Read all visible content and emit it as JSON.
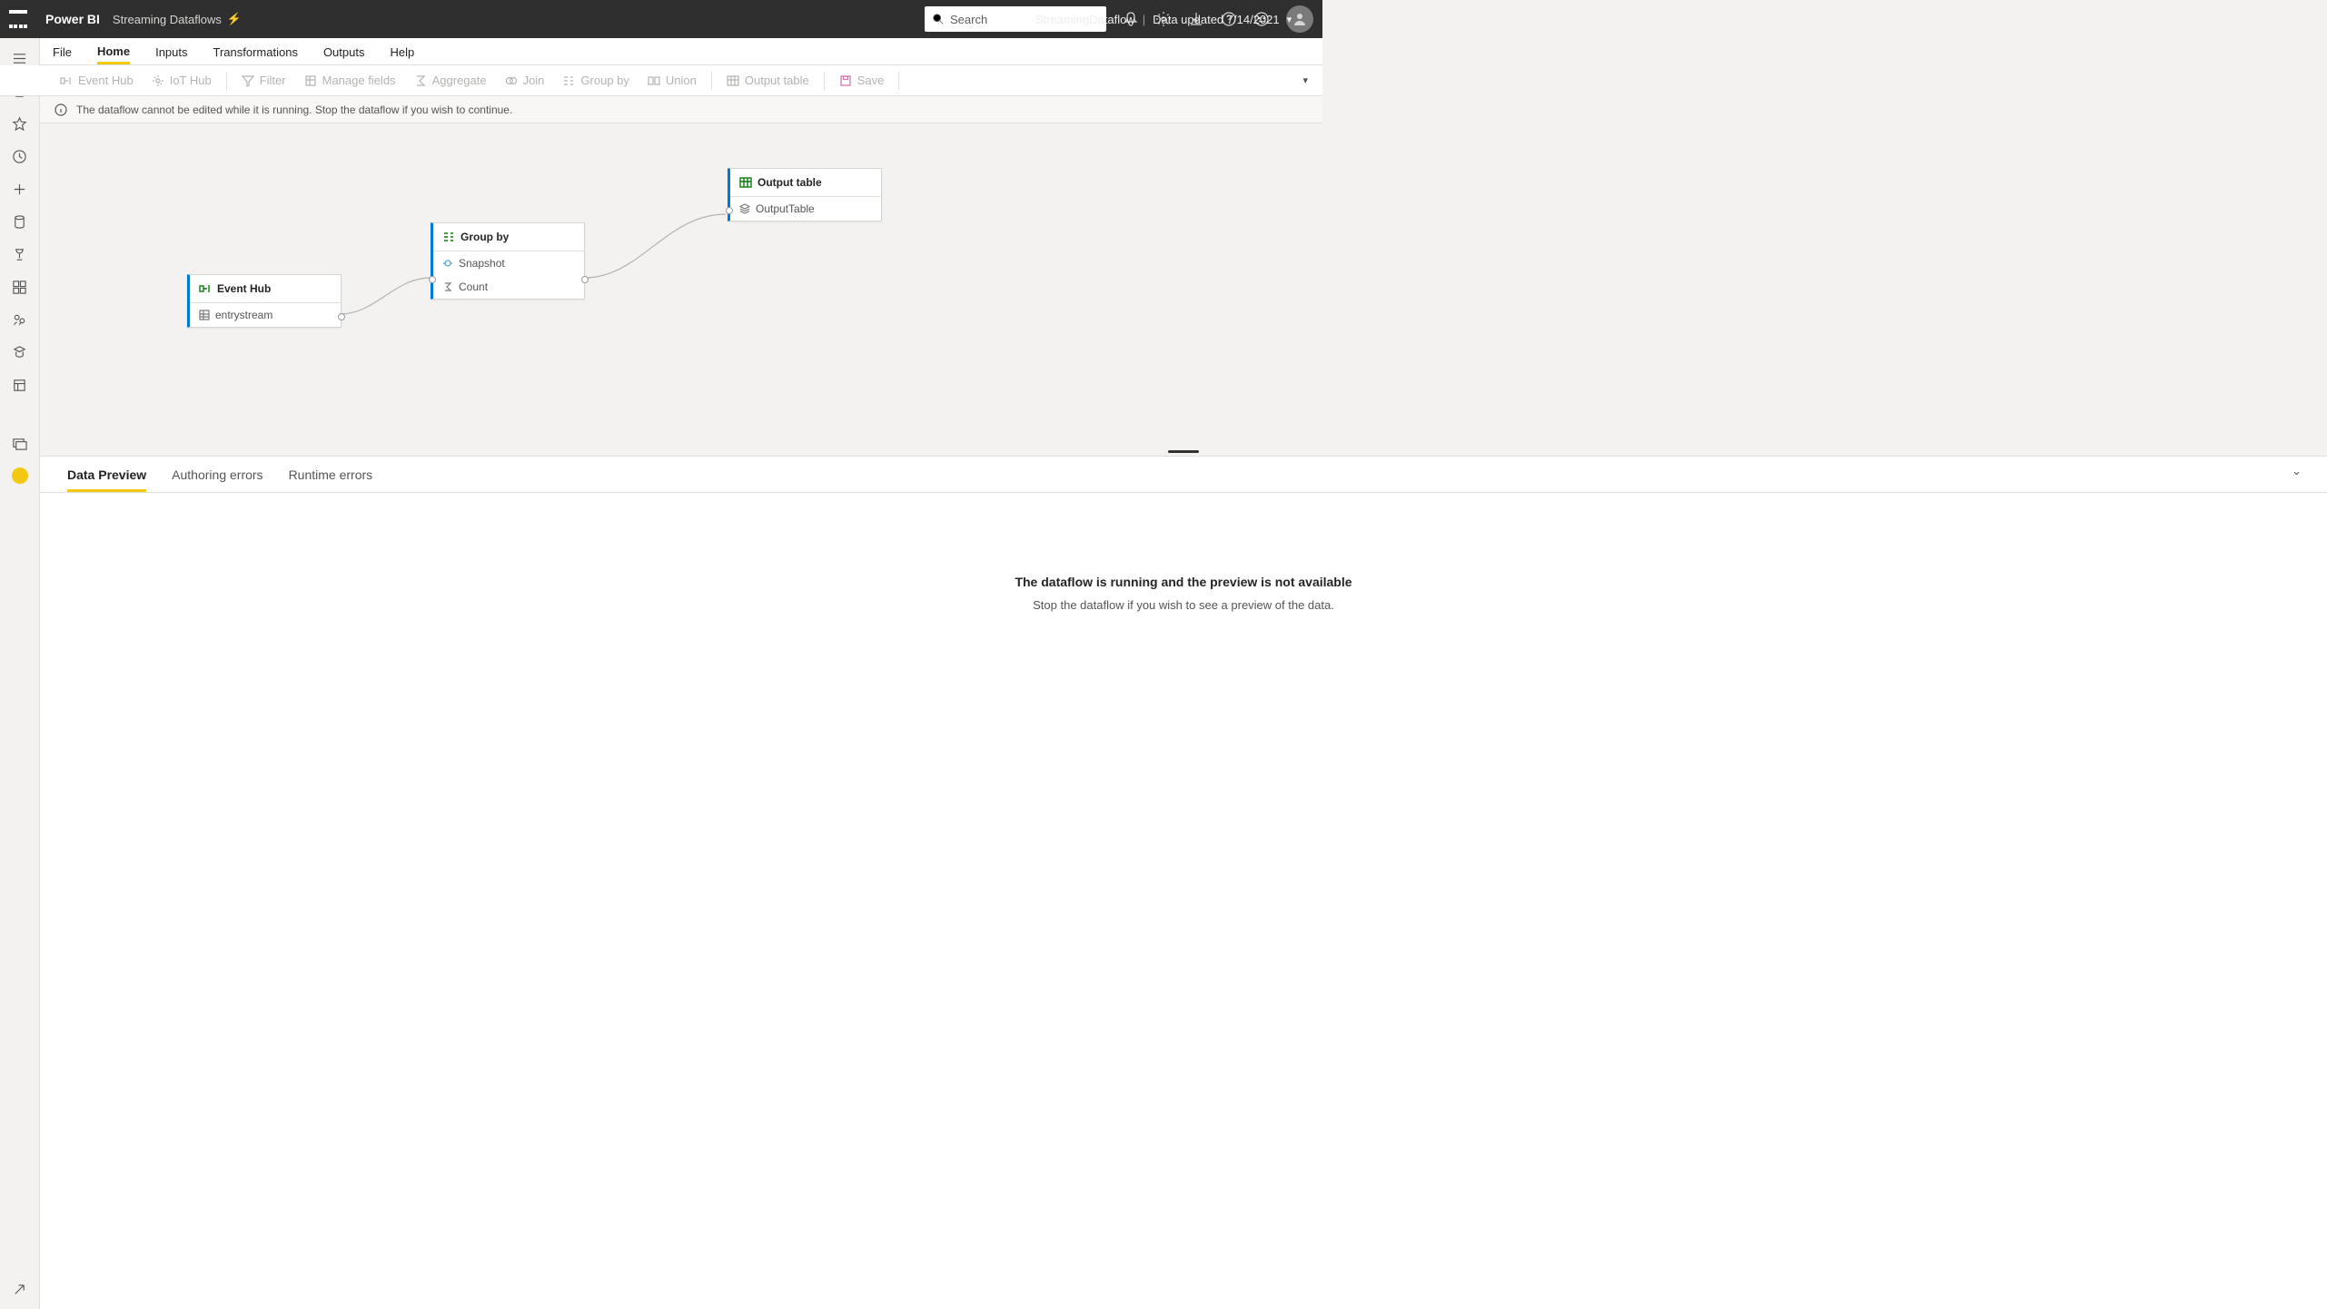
{
  "topbar": {
    "brand": "Power BI",
    "subtitle": "Streaming Dataflows",
    "center_name": "StreamingDataflow",
    "center_updated": "Data updated 7/14/2021",
    "search_placeholder": "Search"
  },
  "menu": {
    "file": "File",
    "home": "Home",
    "inputs": "Inputs",
    "transformations": "Transformations",
    "outputs": "Outputs",
    "help": "Help"
  },
  "ribbon": {
    "event_hub": "Event Hub",
    "iot_hub": "IoT Hub",
    "filter": "Filter",
    "manage_fields": "Manage fields",
    "aggregate": "Aggregate",
    "join": "Join",
    "group_by": "Group by",
    "union": "Union",
    "output_table": "Output table",
    "save": "Save"
  },
  "info_strip": "The dataflow cannot be edited while it is running. Stop the dataflow if you wish to continue.",
  "nodes": {
    "event_hub": {
      "title": "Event Hub",
      "row1": "entrystream"
    },
    "group_by": {
      "title": "Group by",
      "row1": "Snapshot",
      "row2": "Count"
    },
    "output_table": {
      "title": "Output table",
      "row1": "OutputTable"
    }
  },
  "bottom": {
    "tab_preview": "Data Preview",
    "tab_authoring": "Authoring errors",
    "tab_runtime": "Runtime errors",
    "empty_title": "The dataflow is running and the preview is not available",
    "empty_sub": "Stop the dataflow if you wish to see a preview of the data."
  }
}
